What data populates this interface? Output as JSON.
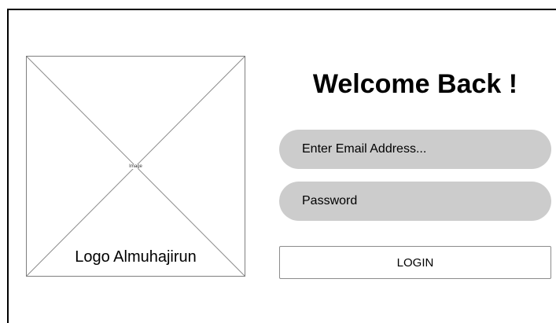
{
  "logo": {
    "image_label": "Image",
    "caption": "Logo Almuhajirun"
  },
  "login_form": {
    "title": "Welcome Back !",
    "email_placeholder": "Enter Email Address...",
    "password_placeholder": "Password",
    "login_label": "LOGIN"
  },
  "colors": {
    "input_fill": "#cccccc",
    "border": "#8c8c8c",
    "text": "#000000"
  }
}
